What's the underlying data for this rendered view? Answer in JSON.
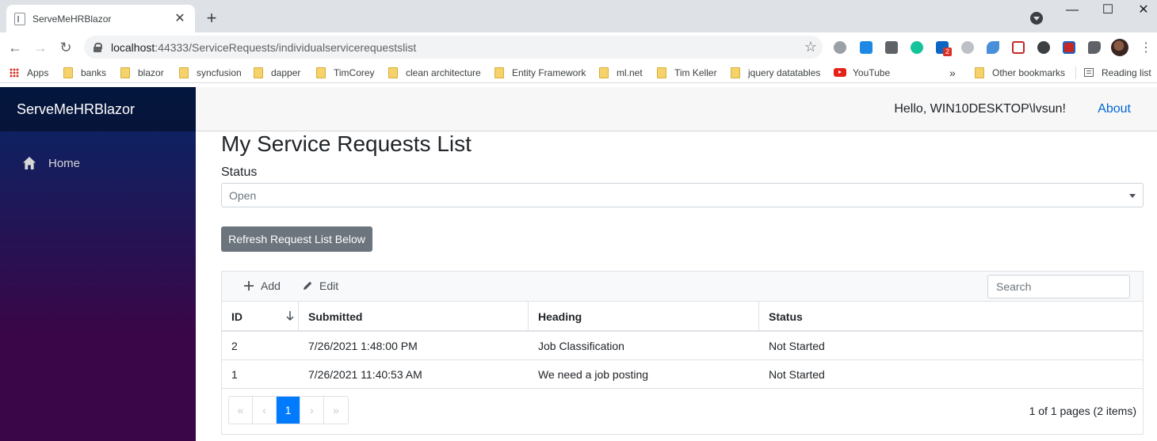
{
  "browser": {
    "tab_title": "ServeMeHRBlazor",
    "tab_close": "✕",
    "new_tab": "+",
    "url_host": "localhost",
    "url_rest": ":44333/ServiceRequests/individualservicerequestslist",
    "extension_badge": "2",
    "bookmarks": [
      {
        "label": "Apps",
        "icon": "apps-icon"
      },
      {
        "label": "banks",
        "icon": "folder-icon"
      },
      {
        "label": "blazor",
        "icon": "folder-icon"
      },
      {
        "label": "syncfusion",
        "icon": "folder-icon"
      },
      {
        "label": "dapper",
        "icon": "folder-icon"
      },
      {
        "label": "TimCorey",
        "icon": "folder-icon"
      },
      {
        "label": "clean architecture",
        "icon": "folder-icon"
      },
      {
        "label": "Entity Framework",
        "icon": "folder-icon"
      },
      {
        "label": "ml.net",
        "icon": "folder-icon"
      },
      {
        "label": "Tim Keller",
        "icon": "folder-icon"
      },
      {
        "label": "jquery datatables",
        "icon": "folder-icon"
      },
      {
        "label": "YouTube",
        "icon": "youtube-icon"
      }
    ],
    "more_bookmarks": "»",
    "other_bookmarks": "Other bookmarks",
    "reading_list": "Reading list"
  },
  "app": {
    "brand": "ServeMeHRBlazor",
    "nav": [
      {
        "label": "Home",
        "icon": "home-icon"
      }
    ],
    "greeting": "Hello, WIN10DESKTOP\\lvsun!",
    "about_link": "About"
  },
  "page": {
    "title": "My Service Requests List",
    "status_label": "Status",
    "status_value": "Open",
    "refresh_button": "Refresh Request List Below"
  },
  "grid": {
    "toolbar": {
      "add": "Add",
      "edit": "Edit",
      "search_placeholder": "Search"
    },
    "columns": [
      "ID",
      "Submitted",
      "Heading",
      "Status"
    ],
    "rows": [
      {
        "id": "2",
        "submitted": "7/26/2021 1:48:00 PM",
        "heading": "Job Classification",
        "status": "Not Started"
      },
      {
        "id": "1",
        "submitted": "7/26/2021 11:40:53 AM",
        "heading": "We need a job posting",
        "status": "Not Started"
      }
    ],
    "pager": {
      "first": "«",
      "prev": "‹",
      "current": "1",
      "next": "›",
      "last": "»",
      "info": "1 of 1 pages (2 items)"
    }
  },
  "colors": {
    "accent": "#007bff",
    "link": "#0366d6",
    "sidebar_top": "#052767",
    "sidebar_bottom": "#3a0647",
    "button": "#6c757d"
  }
}
